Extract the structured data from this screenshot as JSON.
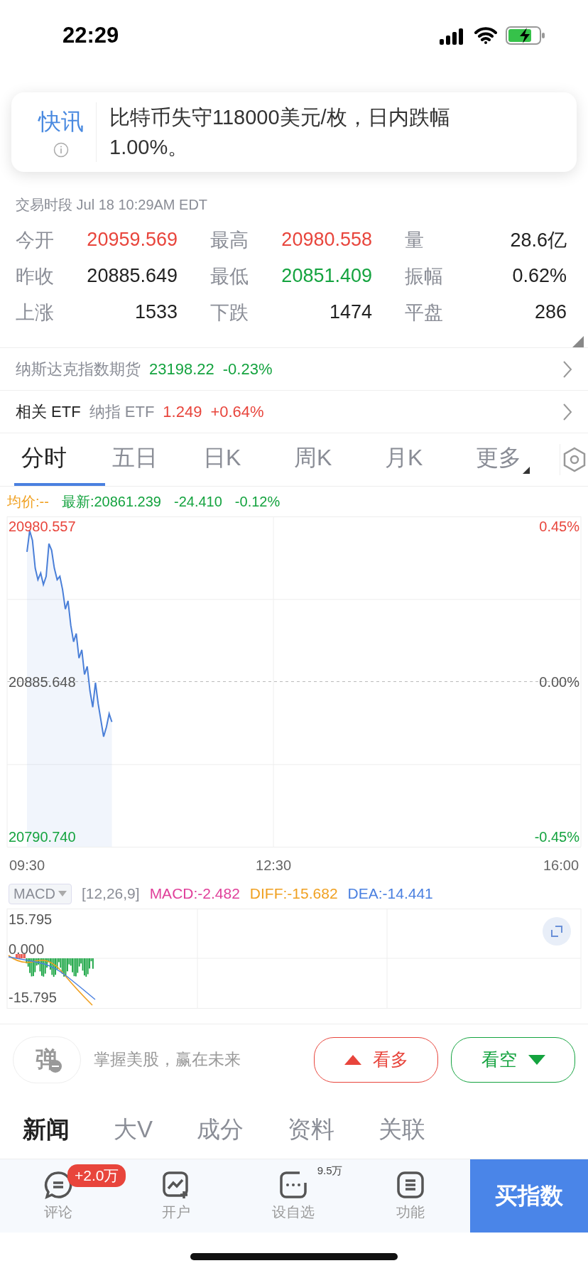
{
  "status_bar": {
    "time": "22:29"
  },
  "flash_news": {
    "label": "快讯",
    "text": "比特币失守118000美元/枚，日内跌幅1.00%。"
  },
  "session": "交易时段 Jul 18 10:29AM EDT",
  "quote_stats": [
    {
      "label": "今开",
      "value": "20959.569",
      "color": "#e8453c"
    },
    {
      "label": "最高",
      "value": "20980.558",
      "color": "#e8453c"
    },
    {
      "label": "量",
      "value": "28.6亿",
      "color": "#222222"
    },
    {
      "label": "昨收",
      "value": "20885.649",
      "color": "#222222"
    },
    {
      "label": "最低",
      "value": "20851.409",
      "color": "#14a33f"
    },
    {
      "label": "振幅",
      "value": "0.62%",
      "color": "#222222"
    },
    {
      "label": "上涨",
      "value": "1533",
      "color": "#222222"
    },
    {
      "label": "下跌",
      "value": "1474",
      "color": "#222222"
    },
    {
      "label": "平盘",
      "value": "286",
      "color": "#222222"
    }
  ],
  "related": [
    {
      "kind": "futures",
      "title": "纳斯达克指数期货",
      "price": "23198.22",
      "change": "-0.23%",
      "color": "#14a33f"
    },
    {
      "kind": "etf",
      "title": "相关 ETF",
      "name": "纳指 ETF",
      "price": "1.249",
      "change": "+0.64%",
      "color": "#e8453c"
    }
  ],
  "chart_tabs": [
    {
      "label": "分时",
      "selected": true,
      "dropdown": false
    },
    {
      "label": "五日",
      "selected": false,
      "dropdown": false
    },
    {
      "label": "日K",
      "selected": false,
      "dropdown": false
    },
    {
      "label": "周K",
      "selected": false,
      "dropdown": false
    },
    {
      "label": "月K",
      "selected": false,
      "dropdown": false
    },
    {
      "label": "更多",
      "selected": false,
      "dropdown": true
    }
  ],
  "intraday": {
    "avg_price": "均价:--",
    "latest": "最新:20861.239",
    "change": "-24.410",
    "change_pct": "-0.12%",
    "percent_labels": [
      "0.45%",
      "0.00%",
      "-0.45%"
    ],
    "chart_data": {
      "type": "area",
      "x": [
        9.5,
        9.533,
        9.567,
        9.6,
        9.633,
        9.667,
        9.7,
        9.733,
        9.767,
        9.8,
        9.833,
        9.867,
        9.9,
        9.933,
        9.967,
        10,
        10.033,
        10.067,
        10.1,
        10.133,
        10.167,
        10.2,
        10.233,
        10.267,
        10.3,
        10.333,
        10.367,
        10.4,
        10.433,
        10.467,
        10.5,
        10.533
      ],
      "series": [
        {
          "color": "#4a7fd8",
          "values": [
            20965,
            20978,
            20972,
            20955,
            20948,
            20952,
            20945,
            20950,
            20970,
            20966,
            20955,
            20948,
            20950,
            20942,
            20930,
            20935,
            20920,
            20910,
            20915,
            20900,
            20905,
            20890,
            20895,
            20880,
            20870,
            20885,
            20872,
            20862,
            20852,
            20858,
            20866,
            20861
          ]
        }
      ],
      "xlim": [
        9.258,
        16.242
      ],
      "ylim": [
        20784.659,
        20986.638
      ],
      "ref_lines": [
        {
          "axis": "y",
          "value": 20885.648
        }
      ],
      "xticks": [
        {
          "value": 9.5,
          "label": "09:30"
        },
        {
          "value": 12.5,
          "label": "12:30"
        },
        {
          "value": 16,
          "label": "16:00"
        }
      ],
      "yticks": [
        {
          "value": 20980.557,
          "label": "20980.557"
        },
        {
          "value": 20885.648,
          "label": "20885.648"
        },
        {
          "value": 20790.74,
          "label": "20790.740"
        }
      ]
    }
  },
  "macd": {
    "indicator": "MACD",
    "params": "[12,26,9]",
    "values": [
      {
        "text": "MACD:-2.482",
        "color": "#e0409a"
      },
      {
        "text": "DIFF:-15.682",
        "color": "#f0a020"
      },
      {
        "text": "DEA:-14.441",
        "color": "#4a80e0"
      }
    ],
    "axis_labels": [
      "15.795",
      "0.000",
      "-15.795"
    ]
  },
  "comment_bar": {
    "icon_text": "弹",
    "placeholder": "掌握美股，赢在未来",
    "bull": "看多",
    "bear": "看空"
  },
  "info_tabs": [
    {
      "label": "新闻",
      "selected": true
    },
    {
      "label": "大V",
      "selected": false
    },
    {
      "label": "成分",
      "selected": false
    },
    {
      "label": "资料",
      "selected": false
    },
    {
      "label": "关联",
      "selected": false
    }
  ],
  "bottom_nav": [
    {
      "kind": "comment",
      "label": "评论",
      "badge": "+2.0万"
    },
    {
      "kind": "open",
      "label": "开户"
    },
    {
      "kind": "watch",
      "label": "设自选",
      "count": "9.5万"
    },
    {
      "kind": "menu",
      "label": "功能"
    }
  ],
  "buy_button": "买指数"
}
